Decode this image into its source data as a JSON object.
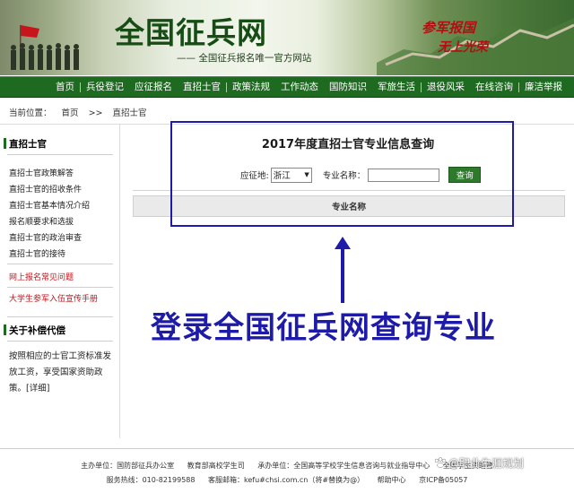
{
  "header": {
    "site_title": "全国征兵网",
    "subtitle": "—— 全国征兵报名唯一官方网站",
    "slogan_line1": "参军报国",
    "slogan_line2": "无上光荣"
  },
  "nav": {
    "items": [
      "首页",
      "兵役登记",
      "应征报名",
      "直招士官",
      "政策法规",
      "工作动态",
      "国防知识",
      "军旅生活",
      "退役风采",
      "在线咨询",
      "廉洁举报"
    ]
  },
  "breadcrumb": {
    "label": "当前位置：",
    "home": "首页",
    "sep": ">>",
    "current": "直招士官"
  },
  "sidebar": {
    "heading1": "直招士官",
    "items": [
      "直招士官政策解答",
      "直招士官的招收条件",
      "直招士官基本情况介绍",
      "报名顺要求和选拔",
      "直招士官的政治审查",
      "直招士官的接待"
    ],
    "red_items": [
      "网上报名常见问题",
      "大学生参军入伍宣传手册"
    ],
    "heading2": "关于补偿代偿",
    "paragraph": "按照相应的士官工资标准发放工资，享受国家资助政策。[详细]"
  },
  "query": {
    "title": "2017年度直招士官专业信息查询",
    "province_label": "应征地:",
    "province_value": "浙江",
    "major_label": "专业名称：",
    "major_value": "",
    "button": "查询",
    "table_header": "专业名称"
  },
  "annotation": {
    "text": "登录全国征兵网查询专业",
    "color": "#1d1ba8"
  },
  "footer": {
    "row1": [
      "主办单位：国防部征兵办公室",
      "教育部高校学生司",
      "承办单位：全国高等学校学生信息咨询与就业指导中心",
      "全国学生资助管"
    ],
    "row2": [
      "服务热线：010-82199588",
      "客服邮箱：kefu#chsi.com.cn（将#替换为@）",
      "帮助中心",
      "京ICP备05057"
    ],
    "watermark": "@职业生涯规划"
  },
  "colors": {
    "nav_green": "#1e6a20",
    "title_green": "#154d14",
    "slogan_red": "#b30e12",
    "link_red": "#c4121a"
  }
}
